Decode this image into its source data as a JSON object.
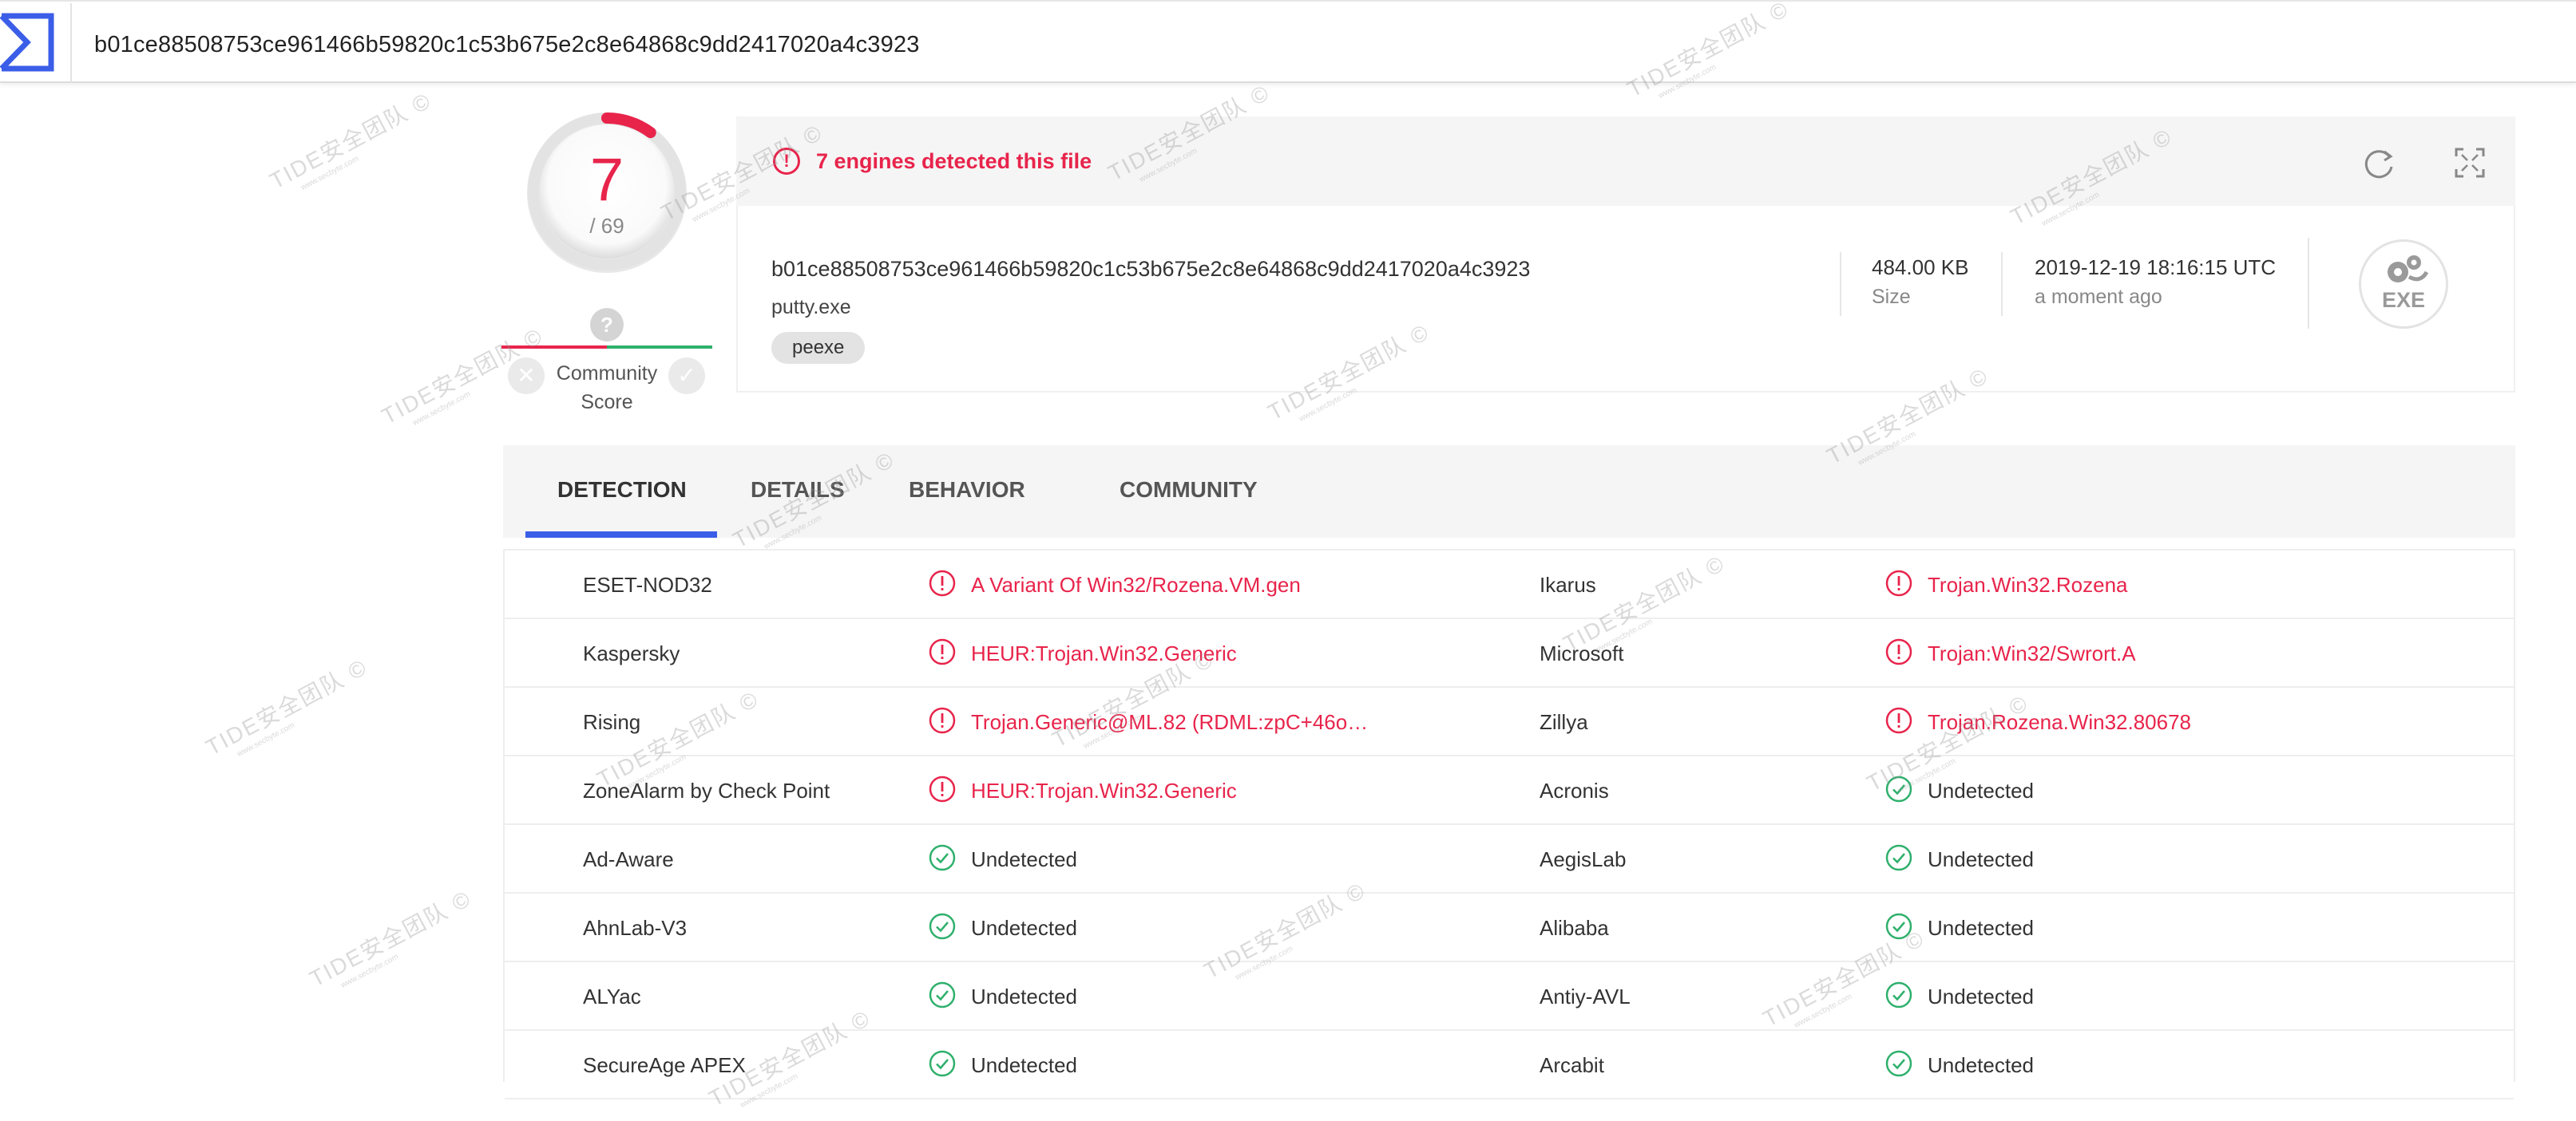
{
  "search": {
    "query": "b01ce88508753ce961466b59820c1c53b675e2c8e64868c9dd2417020a4c3923"
  },
  "score": {
    "detected": "7",
    "total": "/ 69"
  },
  "community": {
    "label_line1": "Community",
    "label_line2": "Score",
    "unknown": "?"
  },
  "banner": {
    "text": "7 engines detected this file"
  },
  "file": {
    "hash": "b01ce88508753ce961466b59820c1c53b675e2c8e64868c9dd2417020a4c3923",
    "name": "putty.exe",
    "tag": "peexe",
    "size_value": "484.00 KB",
    "size_label": "Size",
    "date_value": "2019-12-19 18:16:15 UTC",
    "date_label": "a moment ago",
    "type_label": "EXE"
  },
  "tabs": [
    "DETECTION",
    "DETAILS",
    "BEHAVIOR",
    "COMMUNITY"
  ],
  "detections": [
    {
      "left": {
        "engine": "ESET-NOD32",
        "result": "A Variant Of Win32/Rozena.VM.gen",
        "detected": true
      },
      "right": {
        "engine": "Ikarus",
        "result": "Trojan.Win32.Rozena",
        "detected": true
      }
    },
    {
      "left": {
        "engine": "Kaspersky",
        "result": "HEUR:Trojan.Win32.Generic",
        "detected": true
      },
      "right": {
        "engine": "Microsoft",
        "result": "Trojan:Win32/Swrort.A",
        "detected": true
      }
    },
    {
      "left": {
        "engine": "Rising",
        "result": "Trojan.Generic@ML.82 (RDML:zpC+46o…",
        "detected": true
      },
      "right": {
        "engine": "Zillya",
        "result": "Trojan.Rozena.Win32.80678",
        "detected": true
      }
    },
    {
      "left": {
        "engine": "ZoneAlarm by Check Point",
        "result": "HEUR:Trojan.Win32.Generic",
        "detected": true
      },
      "right": {
        "engine": "Acronis",
        "result": "Undetected",
        "detected": false
      }
    },
    {
      "left": {
        "engine": "Ad-Aware",
        "result": "Undetected",
        "detected": false
      },
      "right": {
        "engine": "AegisLab",
        "result": "Undetected",
        "detected": false
      }
    },
    {
      "left": {
        "engine": "AhnLab-V3",
        "result": "Undetected",
        "detected": false
      },
      "right": {
        "engine": "Alibaba",
        "result": "Undetected",
        "detected": false
      }
    },
    {
      "left": {
        "engine": "ALYac",
        "result": "Undetected",
        "detected": false
      },
      "right": {
        "engine": "Antiy-AVL",
        "result": "Undetected",
        "detected": false
      }
    },
    {
      "left": {
        "engine": "SecureAge APEX",
        "result": "Undetected",
        "detected": false
      },
      "right": {
        "engine": "Arcabit",
        "result": "Undetected",
        "detected": false
      }
    }
  ],
  "watermark": {
    "text": "TIDE安全团队 ©",
    "sub": "www.secbyte.com"
  },
  "colors": {
    "danger": "#e8244b",
    "success": "#2fb06c",
    "accent": "#3b5ee8"
  }
}
